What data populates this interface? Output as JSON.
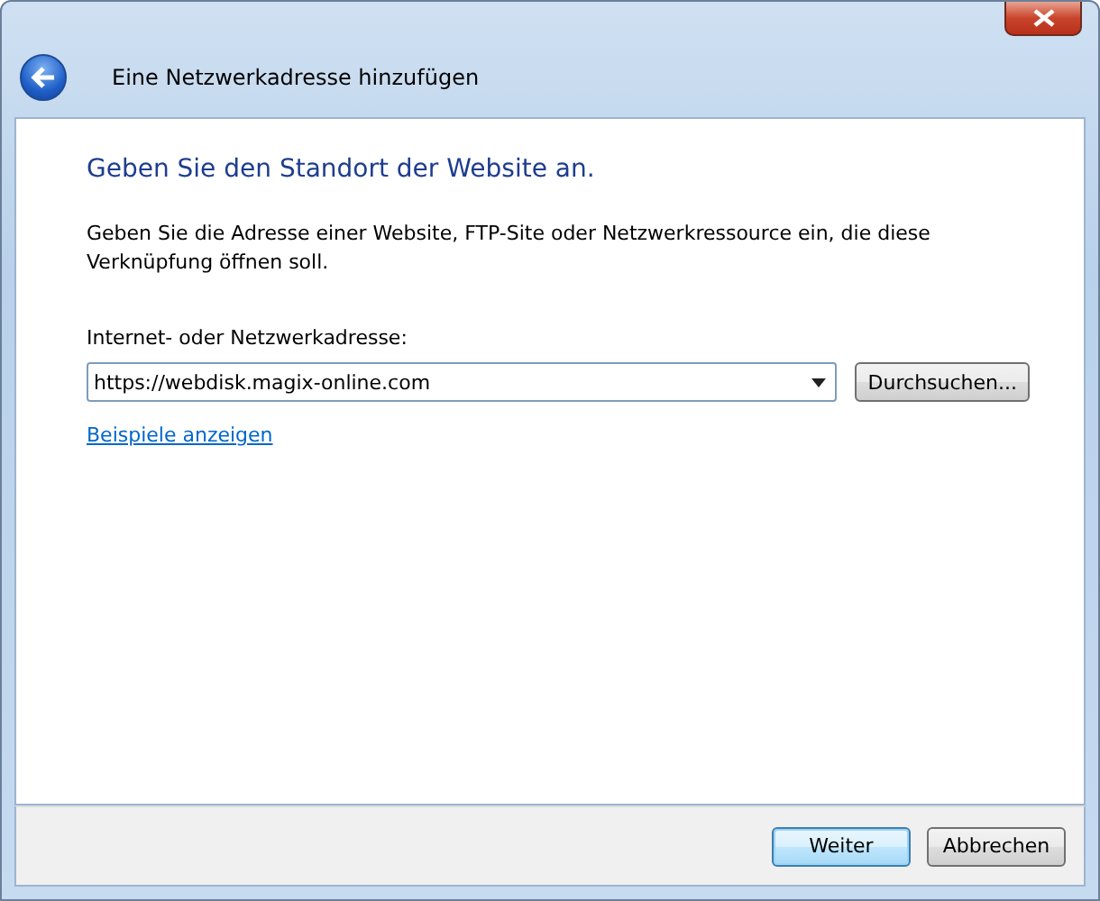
{
  "window": {
    "title": "Eine Netzwerkadresse hinzufügen"
  },
  "heading": "Geben Sie den Standort der Website an.",
  "description": "Geben Sie die Adresse einer Website, FTP-Site oder Netzwerkressource ein, die diese Verknüpfung öffnen soll.",
  "address": {
    "label": "Internet- oder Netzwerkadresse:",
    "value": "https://webdisk.magix-online.com",
    "browse": "Durchsuchen..."
  },
  "examples_link": "Beispiele anzeigen",
  "buttons": [
    {
      "label": "Weiter",
      "default": true
    },
    {
      "label": "Abbrechen",
      "default": false
    }
  ]
}
